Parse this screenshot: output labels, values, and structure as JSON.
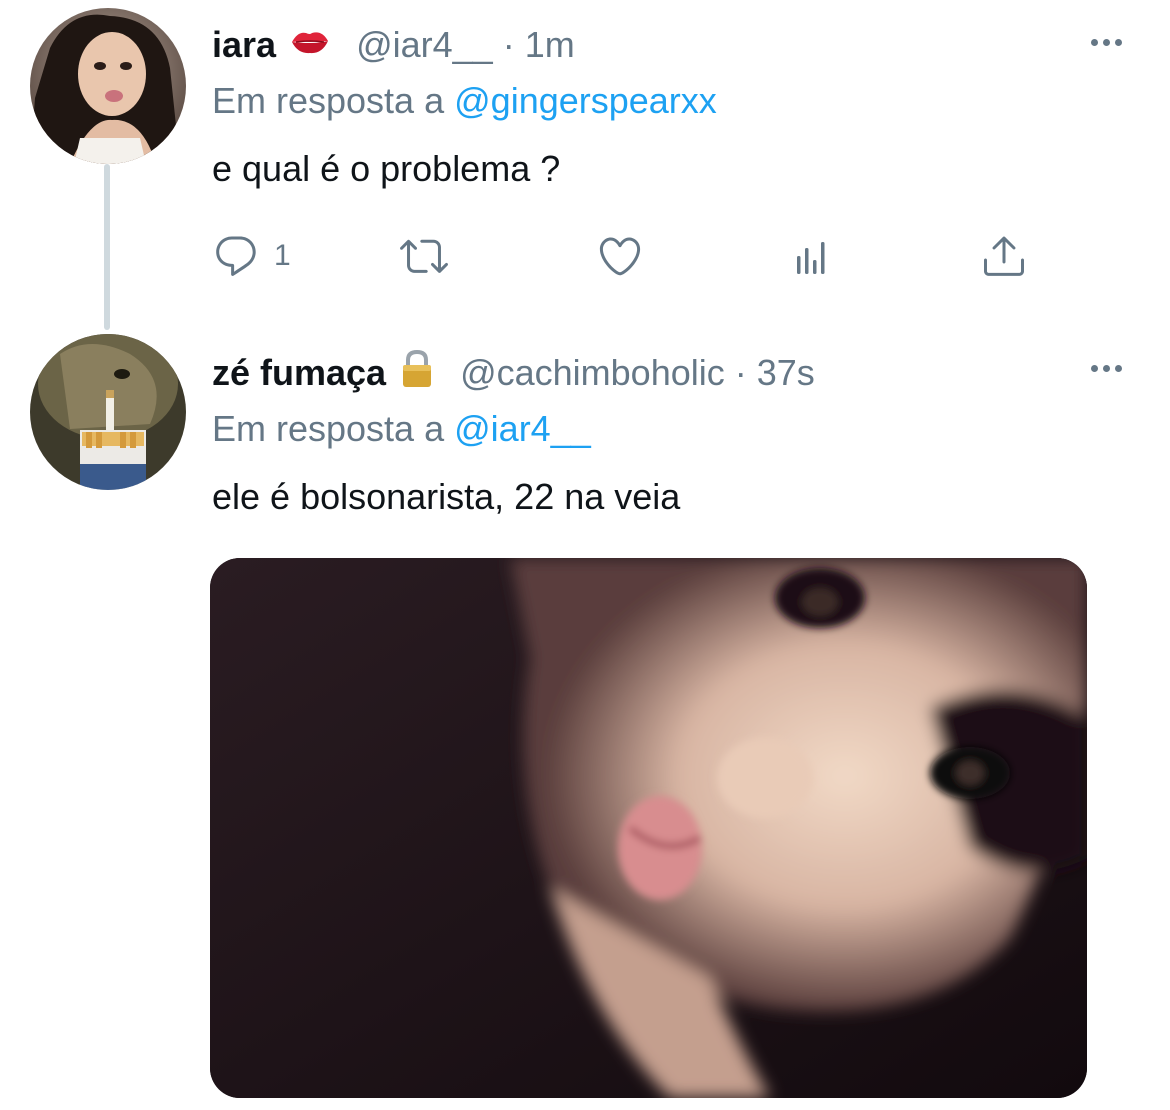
{
  "tweets": [
    {
      "display_name": "iara",
      "name_emoji": "kiss-mark-icon",
      "handle": "@iar4__",
      "separator": "·",
      "timestamp": "1m",
      "reply_prefix": "Em resposta a",
      "reply_to": "@gingerspearxx",
      "text": "e qual é o problema ?",
      "reply_count": "1"
    },
    {
      "display_name": "zé fumaça",
      "name_emoji": "lock-icon",
      "handle": "@cachimboholic",
      "separator": "·",
      "timestamp": "37s",
      "reply_prefix": "Em resposta a",
      "reply_to": "@iar4__",
      "text": "ele é bolsonarista, 22 na veia"
    }
  ],
  "colors": {
    "link": "#1da1f2",
    "secondary": "#657786",
    "thread_line": "#cfd9de"
  }
}
